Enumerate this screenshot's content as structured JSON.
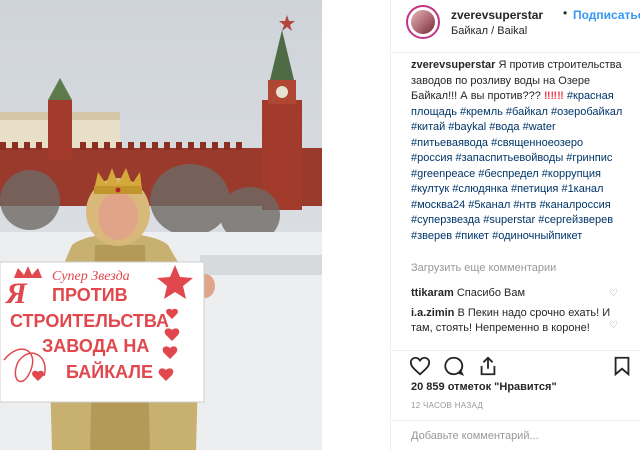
{
  "photo": {
    "sign_lines": [
      "Супер Звезда",
      "ПРОТИВ",
      "СТРОИТЕЛЬСТВА",
      "ЗАВОДА НА",
      "БАЙКАЛЕ"
    ],
    "sign_letter": "Я"
  },
  "header": {
    "username": "zverevsuperstar",
    "dot": "•",
    "follow_label": "Подписаться",
    "location": "Байкал / Baikal"
  },
  "caption": {
    "username": "zverevsuperstar",
    "text": "Я против строительства заводов по розливу воды на Озере Байкал!!! А вы против???",
    "marks": "‼‼‼",
    "hashtags": "#красная​площадь #кремль #байкал #озеробайкал #китай #baykal #вода #water #питьеваявода #священноеозеро #россия #запаспитьевойводы #гринпис #greenpeace #беспредел #коррупция #култук #слюдянка #петиция #1канал #москва24 #5канал #нтв #каналроссия #суперзвезда #superstar #сергейзверев #зверев #пикет #одиночныйпикет"
  },
  "load_more": "Загрузить еще комментарии",
  "comments": [
    {
      "user": "ttikaram",
      "text": "Спасибо Вам"
    },
    {
      "user": "i.a.zimin",
      "text": "В Пекин надо срочно ехать! И там, стоять! Непременно в короне!"
    }
  ],
  "likes": "20 859 отметок \"Нравится\"",
  "time": "12 ЧАСОВ НАЗАД",
  "add_comment_placeholder": "Добавьте комментарий...",
  "more_icon_glyph": "⋯"
}
